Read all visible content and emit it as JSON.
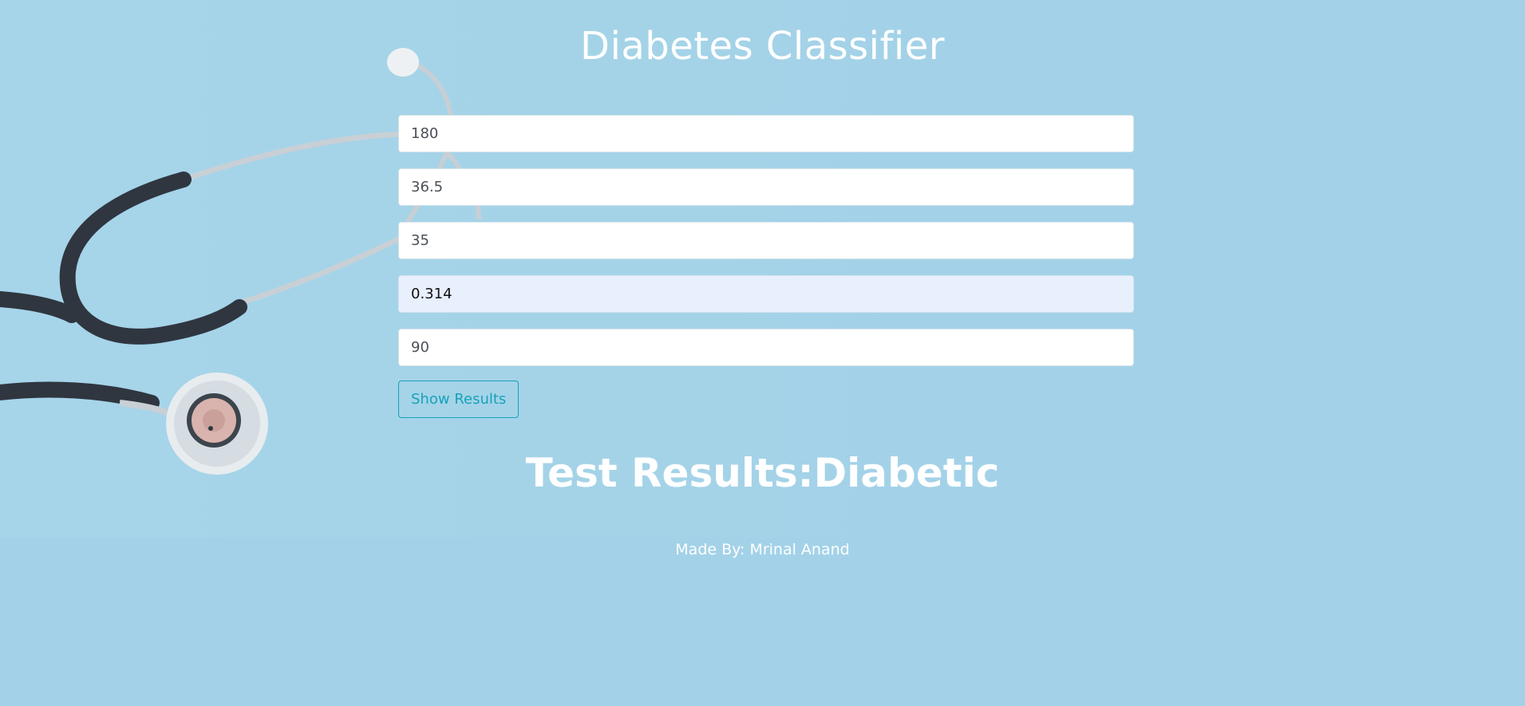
{
  "page": {
    "title": "Diabetes Classifier",
    "background_color": "#a3d2e8"
  },
  "form": {
    "fields": [
      {
        "value": "180"
      },
      {
        "value": "36.5"
      },
      {
        "value": "35"
      },
      {
        "value": "0.314"
      },
      {
        "value": "90"
      }
    ],
    "submit_label": "Show Results",
    "accent_color": "#17a2b8"
  },
  "result": {
    "label": "Test Results:",
    "value": "Diabetic"
  },
  "footer": {
    "text": "Made By: Mrinal Anand"
  },
  "background_image": {
    "icon": "stethoscope-icon"
  }
}
